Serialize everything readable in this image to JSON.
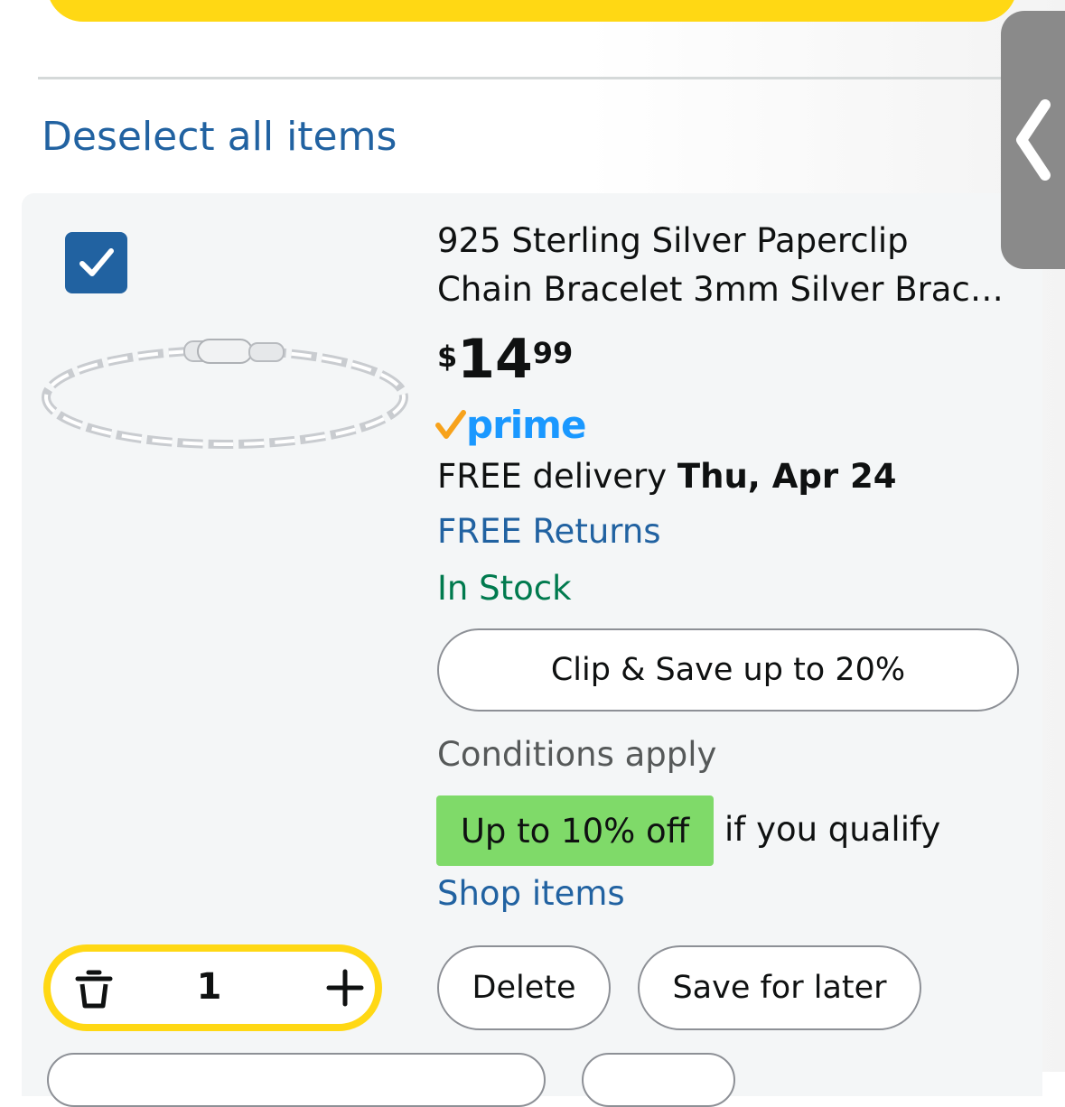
{
  "top_bar": {
    "color": "#ffd814"
  },
  "deselect_link": "Deselect all items",
  "item": {
    "checked": true,
    "title_line1": "925 Sterling Silver Paperclip",
    "title_line2": "Chain Bracelet 3mm Silver Brac…",
    "price": {
      "currency": "$",
      "whole": "14",
      "fraction": "99"
    },
    "prime_label": "prime",
    "delivery_prefix": "FREE delivery ",
    "delivery_date": "Thu, Apr 24",
    "returns": "FREE Returns",
    "stock": "In Stock",
    "coupon_button": "Clip & Save up to 20%",
    "conditions": "Conditions apply",
    "promo_badge": "Up to 10% off",
    "promo_text": "if you qualify",
    "shop_link": "Shop items",
    "quantity": "1",
    "delete_label": "Delete",
    "save_label": "Save for later"
  },
  "colors": {
    "link": "#2162a1",
    "in_stock": "#007a4e",
    "promo_badge": "#7fda69",
    "accent_yellow": "#ffd814",
    "checkbox": "#2162a1",
    "prime": "#1a98ff"
  },
  "icons": [
    "checkmark-icon",
    "prime-check-icon",
    "trash-icon",
    "plus-icon",
    "chevron-left-icon"
  ]
}
